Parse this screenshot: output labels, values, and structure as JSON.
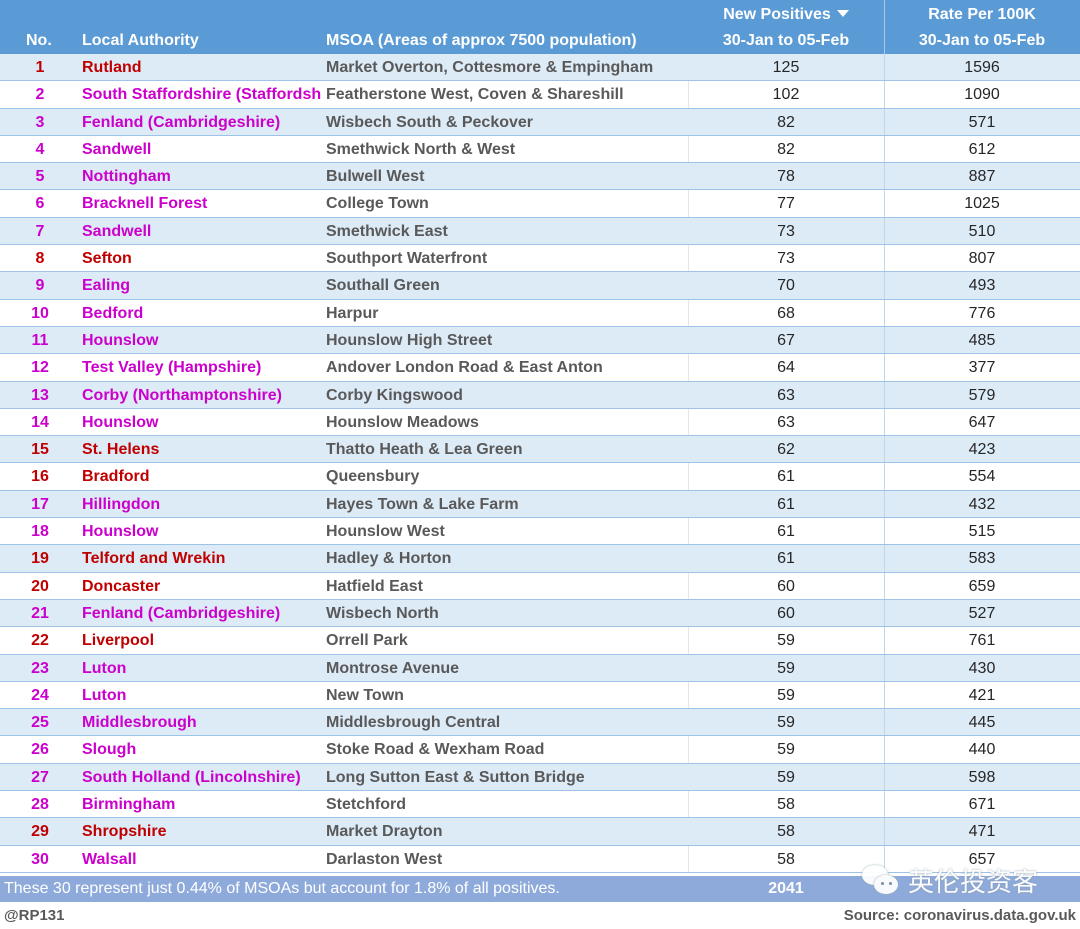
{
  "colors": {
    "header_bg": "#5b9bd5",
    "band_bg": "#ddebf7",
    "footer_bg": "#8eaadb",
    "red": "#c00000",
    "magenta": "#cc00cc"
  },
  "header": {
    "no": "No.",
    "local_authority": "Local Authority",
    "msoa": "MSOA (Areas of approx 7500 population)",
    "new_positives": "New Positives",
    "new_positives_period": "30-Jan to 05-Feb",
    "rate": "Rate Per 100K",
    "rate_period": "30-Jan to 05-Feb",
    "sort_icon": "sort-descending-icon"
  },
  "rows": [
    {
      "no": "1",
      "la": "Rutland",
      "msoa": "Market Overton, Cottesmore & Empingham",
      "np": "125",
      "rate": "1596",
      "color": "red"
    },
    {
      "no": "2",
      "la": "South Staffordshire (Staffordsh",
      "msoa": "Featherstone West, Coven & Shareshill",
      "np": "102",
      "rate": "1090",
      "color": "magenta"
    },
    {
      "no": "3",
      "la": "Fenland (Cambridgeshire)",
      "msoa": "Wisbech South & Peckover",
      "np": "82",
      "rate": "571",
      "color": "magenta"
    },
    {
      "no": "4",
      "la": "Sandwell",
      "msoa": "Smethwick North & West",
      "np": "82",
      "rate": "612",
      "color": "magenta"
    },
    {
      "no": "5",
      "la": "Nottingham",
      "msoa": "Bulwell West",
      "np": "78",
      "rate": "887",
      "color": "magenta"
    },
    {
      "no": "6",
      "la": "Bracknell Forest",
      "msoa": "College Town",
      "np": "77",
      "rate": "1025",
      "color": "magenta"
    },
    {
      "no": "7",
      "la": "Sandwell",
      "msoa": "Smethwick East",
      "np": "73",
      "rate": "510",
      "color": "magenta"
    },
    {
      "no": "8",
      "la": "Sefton",
      "msoa": "Southport Waterfront",
      "np": "73",
      "rate": "807",
      "color": "red"
    },
    {
      "no": "9",
      "la": "Ealing",
      "msoa": "Southall Green",
      "np": "70",
      "rate": "493",
      "color": "magenta"
    },
    {
      "no": "10",
      "la": "Bedford",
      "msoa": "Harpur",
      "np": "68",
      "rate": "776",
      "color": "magenta"
    },
    {
      "no": "11",
      "la": "Hounslow",
      "msoa": "Hounslow High Street",
      "np": "67",
      "rate": "485",
      "color": "magenta"
    },
    {
      "no": "12",
      "la": "Test Valley (Hampshire)",
      "msoa": "Andover London Road & East Anton",
      "np": "64",
      "rate": "377",
      "color": "magenta"
    },
    {
      "no": "13",
      "la": "Corby (Northamptonshire)",
      "msoa": "Corby Kingswood",
      "np": "63",
      "rate": "579",
      "color": "magenta"
    },
    {
      "no": "14",
      "la": "Hounslow",
      "msoa": "Hounslow Meadows",
      "np": "63",
      "rate": "647",
      "color": "magenta"
    },
    {
      "no": "15",
      "la": "St. Helens",
      "msoa": "Thatto Heath & Lea Green",
      "np": "62",
      "rate": "423",
      "color": "red"
    },
    {
      "no": "16",
      "la": "Bradford",
      "msoa": "Queensbury",
      "np": "61",
      "rate": "554",
      "color": "red"
    },
    {
      "no": "17",
      "la": "Hillingdon",
      "msoa": "Hayes Town & Lake Farm",
      "np": "61",
      "rate": "432",
      "color": "magenta"
    },
    {
      "no": "18",
      "la": "Hounslow",
      "msoa": "Hounslow West",
      "np": "61",
      "rate": "515",
      "color": "magenta"
    },
    {
      "no": "19",
      "la": "Telford and Wrekin",
      "msoa": "Hadley & Horton",
      "np": "61",
      "rate": "583",
      "color": "red"
    },
    {
      "no": "20",
      "la": "Doncaster",
      "msoa": "Hatfield East",
      "np": "60",
      "rate": "659",
      "color": "red"
    },
    {
      "no": "21",
      "la": "Fenland (Cambridgeshire)",
      "msoa": "Wisbech North",
      "np": "60",
      "rate": "527",
      "color": "magenta"
    },
    {
      "no": "22",
      "la": "Liverpool",
      "msoa": "Orrell Park",
      "np": "59",
      "rate": "761",
      "color": "red"
    },
    {
      "no": "23",
      "la": "Luton",
      "msoa": "Montrose Avenue",
      "np": "59",
      "rate": "430",
      "color": "magenta"
    },
    {
      "no": "24",
      "la": "Luton",
      "msoa": "New Town",
      "np": "59",
      "rate": "421",
      "color": "magenta"
    },
    {
      "no": "25",
      "la": "Middlesbrough",
      "msoa": "Middlesbrough Central",
      "np": "59",
      "rate": "445",
      "color": "magenta"
    },
    {
      "no": "26",
      "la": "Slough",
      "msoa": "Stoke Road & Wexham Road",
      "np": "59",
      "rate": "440",
      "color": "magenta"
    },
    {
      "no": "27",
      "la": "South Holland (Lincolnshire)",
      "msoa": "Long Sutton East & Sutton Bridge",
      "np": "59",
      "rate": "598",
      "color": "magenta"
    },
    {
      "no": "28",
      "la": "Birmingham",
      "msoa": "Stetchford",
      "np": "58",
      "rate": "671",
      "color": "magenta"
    },
    {
      "no": "29",
      "la": "Shropshire",
      "msoa": "Market Drayton",
      "np": "58",
      "rate": "471",
      "color": "red"
    },
    {
      "no": "30",
      "la": "Walsall",
      "msoa": "Darlaston West",
      "np": "58",
      "rate": "657",
      "color": "magenta"
    }
  ],
  "footer": {
    "note": "These 30 represent just 0.44% of MSOAs but account for 1.8% of all positives.",
    "total": "2041"
  },
  "credit": "@RP131",
  "source": "Source: coronavirus.data.gov.uk",
  "watermark": {
    "icon": "wechat-icon",
    "text": "英伦投资客"
  }
}
